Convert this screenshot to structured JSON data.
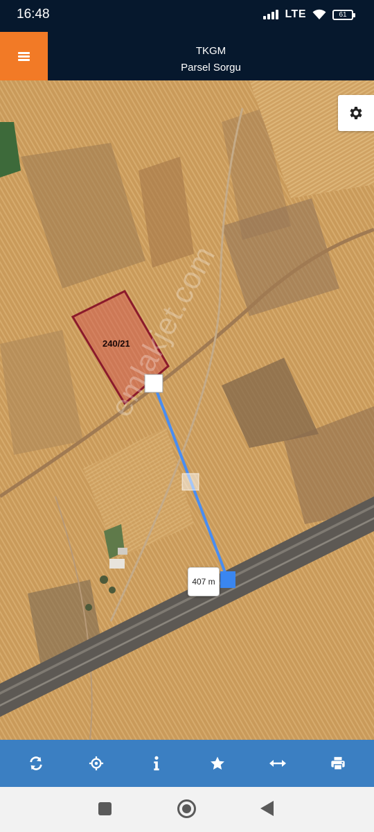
{
  "status_bar": {
    "time": "16:48",
    "network": "LTE",
    "battery": "61",
    "icons": [
      "signal-icon",
      "wifi-icon",
      "battery-icon"
    ]
  },
  "header": {
    "title": "TKGM",
    "subtitle": "Parsel Sorgu",
    "menu_icon": "hamburger-icon",
    "accent_color": "#f27a26",
    "background_color": "#06182d"
  },
  "map": {
    "parcel_label": "240/21",
    "distance_label": "407 m",
    "watermark": "emlakjet.com",
    "parcel_border_color": "#8b1a2b",
    "measure_line_color": "#4a8df0",
    "settings_icon": "gear-icon"
  },
  "toolbar": {
    "background_color": "#3b7fc2",
    "items": [
      {
        "icon": "refresh-icon"
      },
      {
        "icon": "locate-icon"
      },
      {
        "icon": "info-icon"
      },
      {
        "icon": "star-icon"
      },
      {
        "icon": "measure-icon"
      },
      {
        "icon": "print-icon"
      }
    ]
  },
  "nav_bar": {
    "icons": [
      "recents-icon",
      "home-icon",
      "back-icon"
    ]
  }
}
